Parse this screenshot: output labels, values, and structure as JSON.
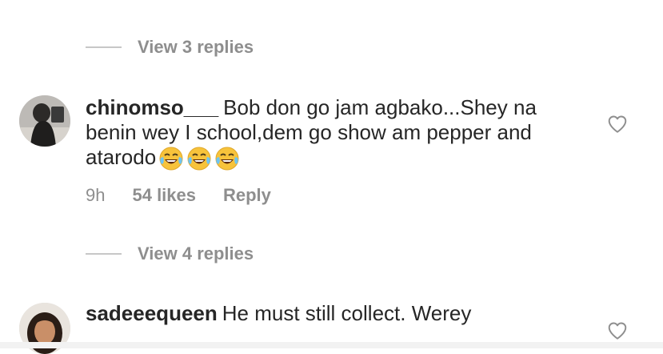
{
  "thread1": {
    "view_replies_label": "View 3 replies"
  },
  "comment1": {
    "username": "chinomso___",
    "text": "Bob don go jam agbako...Shey na benin wey I school,dem go show am pepper and atarodo",
    "emojis": [
      "face-with-tears-of-joy",
      "face-with-tears-of-joy",
      "face-with-tears-of-joy"
    ],
    "time": "9h",
    "likes": "54 likes",
    "reply_label": "Reply",
    "like_icon": "heart-outline-icon"
  },
  "thread2": {
    "view_replies_label": "View 4 replies"
  },
  "comment2": {
    "username": "sadeeequeen",
    "text": "He must still collect. Werey",
    "like_icon": "heart-outline-icon"
  },
  "colors": {
    "text": "#262626",
    "secondary": "#8e8e8e",
    "divider": "#c7c7c7",
    "emoji_face": "#f7c33b"
  }
}
